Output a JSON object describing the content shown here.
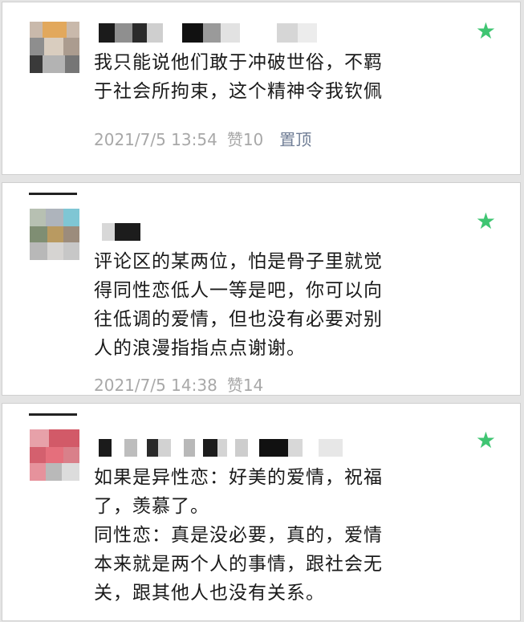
{
  "colors": {
    "star": "#3fc572",
    "meta": "#a8a8a8",
    "pin": "#6f7d95"
  },
  "comments": [
    {
      "star_icon": "★",
      "lines": [
        "我只能说他们敢于冲破世俗，不羁",
        "于社会所拘束，这个精神令我钦佩"
      ],
      "time": "2021/7/5 13:54",
      "likes": "赞10",
      "pin": "置顶"
    },
    {
      "star_icon": "★",
      "lines": [
        "评论区的某两位，怕是骨子里就觉",
        "得同性恋低人一等是吧，你可以向",
        "往低调的爱情，但也没有必要对别",
        "人的浪漫指指点点谢谢。"
      ],
      "time": "2021/7/5 14:38",
      "likes": "赞14"
    },
    {
      "star_icon": "★",
      "lines": [
        "如果是异性恋：好美的爱情，祝福",
        "了，羡慕了。",
        "同性恋：真是没必要，真的，爱情",
        "本来就是两个人的事情，跟社会无",
        "关，跟其他人也没有关系。"
      ]
    }
  ]
}
